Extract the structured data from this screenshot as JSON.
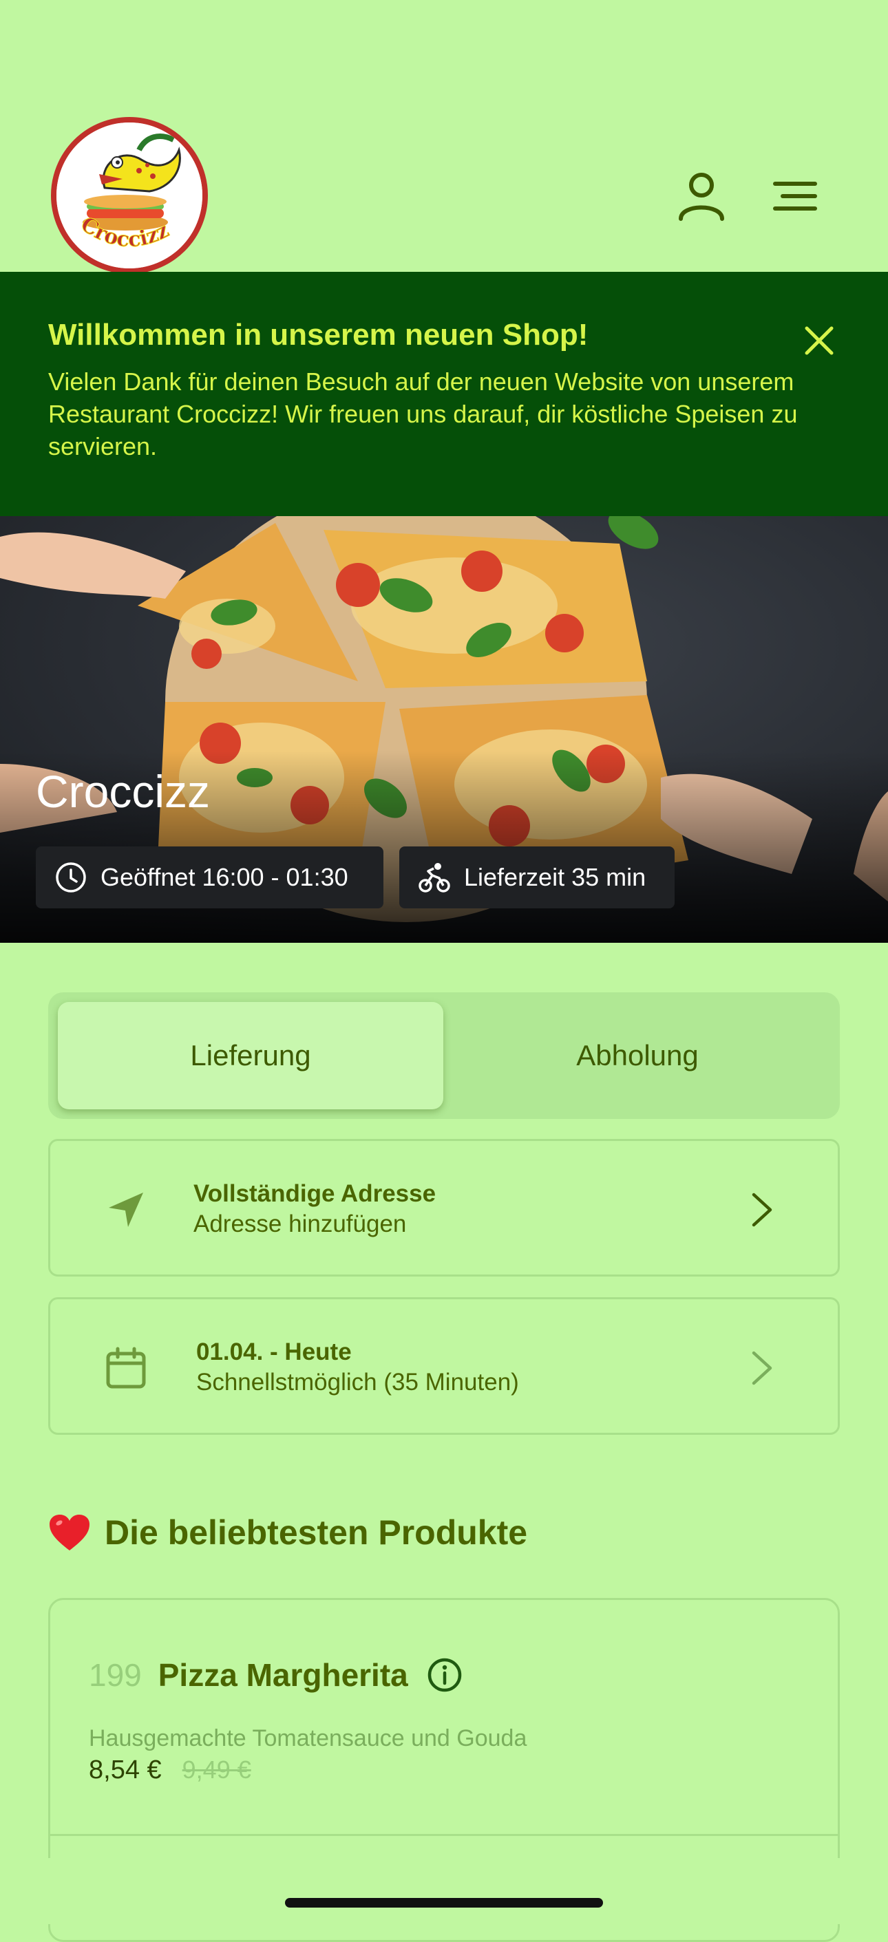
{
  "header": {
    "logo_text": "Croccizz"
  },
  "banner": {
    "title": "Willkommen in unserem neuen Shop!",
    "text": "Vielen Dank für deinen Besuch auf der neuen Website von unserem Restaurant Croccizz! Wir freuen uns darauf, dir köstliche Speisen zu servieren."
  },
  "hero": {
    "title": "Croccizz",
    "opening_hours": "Geöffnet 16:00 - 01:30",
    "delivery_time": "Lieferzeit 35 min"
  },
  "order_mode": {
    "options": [
      "Lieferung",
      "Abholung"
    ],
    "selected": "Lieferung"
  },
  "address_card": {
    "title": "Vollständige Adresse",
    "subtitle": "Adresse hinzufügen"
  },
  "time_card": {
    "title": "01.04. - Heute",
    "subtitle": "Schnellstmöglich (35 Minuten)"
  },
  "popular": {
    "title": "Die beliebtesten Produkte",
    "products": [
      {
        "number": "199",
        "name": "Pizza Margherita",
        "description": "Hausgemachte Tomatensauce und Gouda",
        "price": "8,54 €",
        "old_price": "9,49 €"
      }
    ]
  },
  "colors": {
    "background": "#c0f7a0",
    "banner": "#054f08",
    "banner_text": "#d6f54a",
    "primary_text": "#4a6500"
  }
}
